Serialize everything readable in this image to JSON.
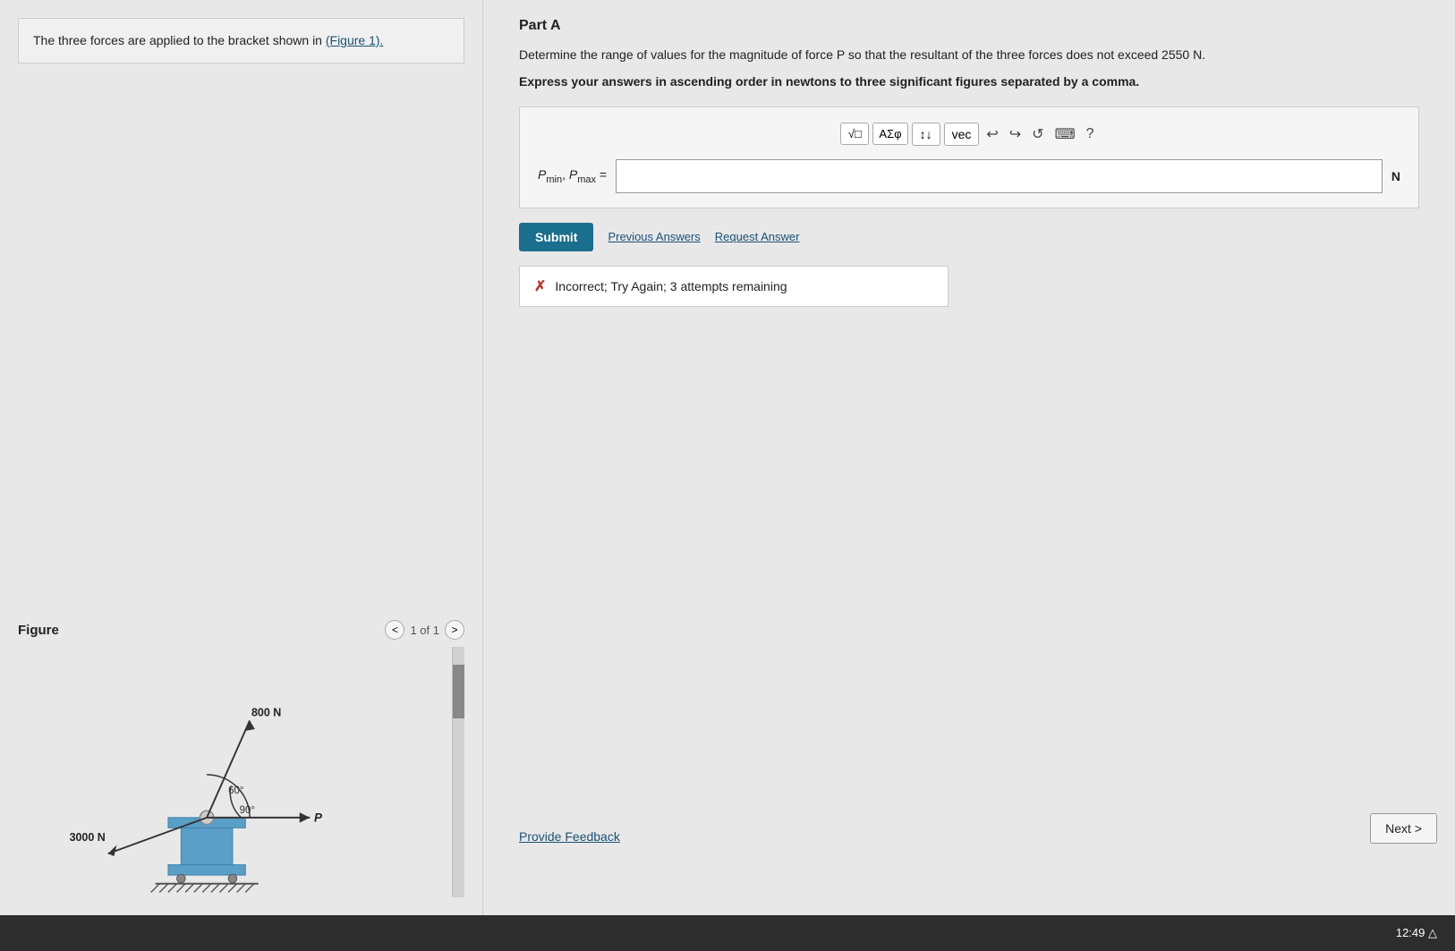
{
  "left": {
    "problem_text": "The three forces are applied to the bracket shown in",
    "problem_link": "(Figure 1).",
    "figure_label": "Figure",
    "figure_nav_text": "1 of 1",
    "figure_800N": "800 N",
    "figure_3000N": "3000 N",
    "figure_angle1": "90°",
    "figure_angle2": "60°",
    "figure_P": "P"
  },
  "right": {
    "part_label": "Part A",
    "question_text": "Determine the range of values for the magnitude of force P so that the resultant of the three forces does not exceed 2550 N.",
    "instruction_text": "Express your answers in ascending order in newtons to three significant figures separated by a comma.",
    "answer_label": "P",
    "answer_label_min": "min",
    "answer_label_max": "max",
    "unit": "N",
    "answer_value": "",
    "toolbar": {
      "math_btn": "√□",
      "symbols_btn": "AΣφ",
      "arrows_btn": "↕↓",
      "vec_btn": "vec",
      "undo_icon": "↩",
      "redo_icon": "↪",
      "refresh_icon": "↺",
      "keyboard_icon": "⌨",
      "help_icon": "?"
    },
    "submit_label": "Submit",
    "prev_answers_label": "Previous Answers",
    "request_answer_label": "Request Answer",
    "error_text": "Incorrect; Try Again; 3 attempts remaining",
    "provide_feedback_label": "Provide Feedback",
    "next_label": "Next >"
  },
  "taskbar": {
    "time": "12:49 △"
  }
}
